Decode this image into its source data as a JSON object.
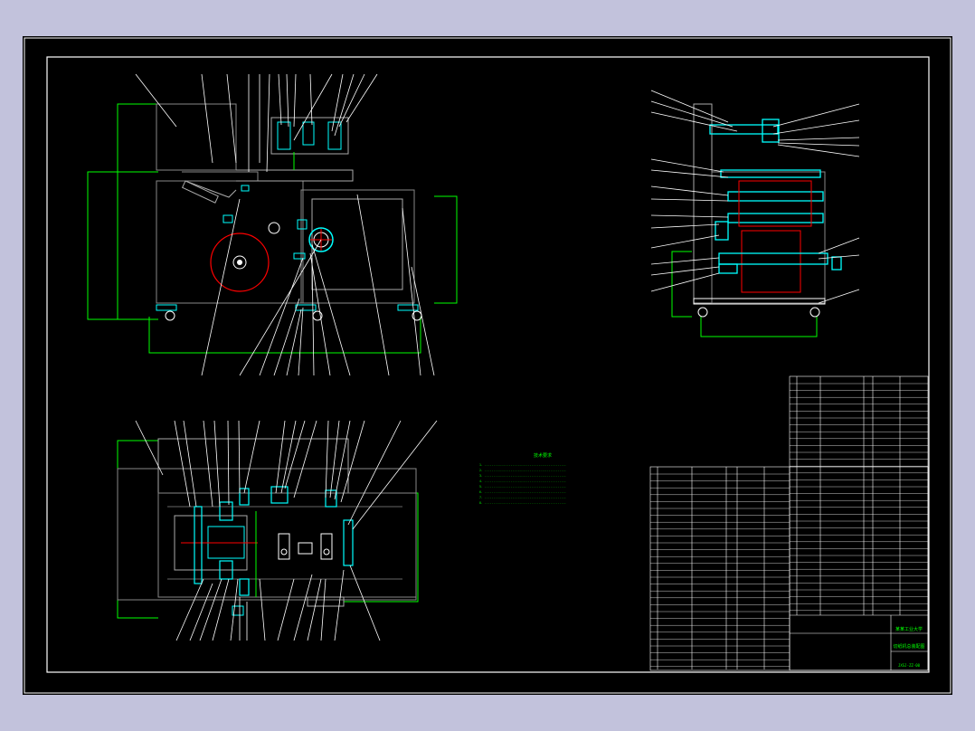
{
  "drawing": {
    "notes_title": "技术要求",
    "notes": [
      "1. ...............................................",
      "2. ...............................................",
      "3. ...............................................",
      "4. ...............................................",
      "5. ...............................................",
      "6. ...............................................",
      "7. ...............................................",
      "8. ..............................................."
    ],
    "title_block": {
      "school": "某某工业大学",
      "drawing_name": "切纸机总装配图",
      "drawing_no": "JXSJ-ZZ-00"
    }
  },
  "colors": {
    "page_background": "#c2c2dc",
    "sheet": "#000000",
    "lines": "#ffffff",
    "outline": "#00ff00",
    "parts": "#00ffff",
    "highlight": "#ff0000",
    "text": "#00ff00"
  }
}
